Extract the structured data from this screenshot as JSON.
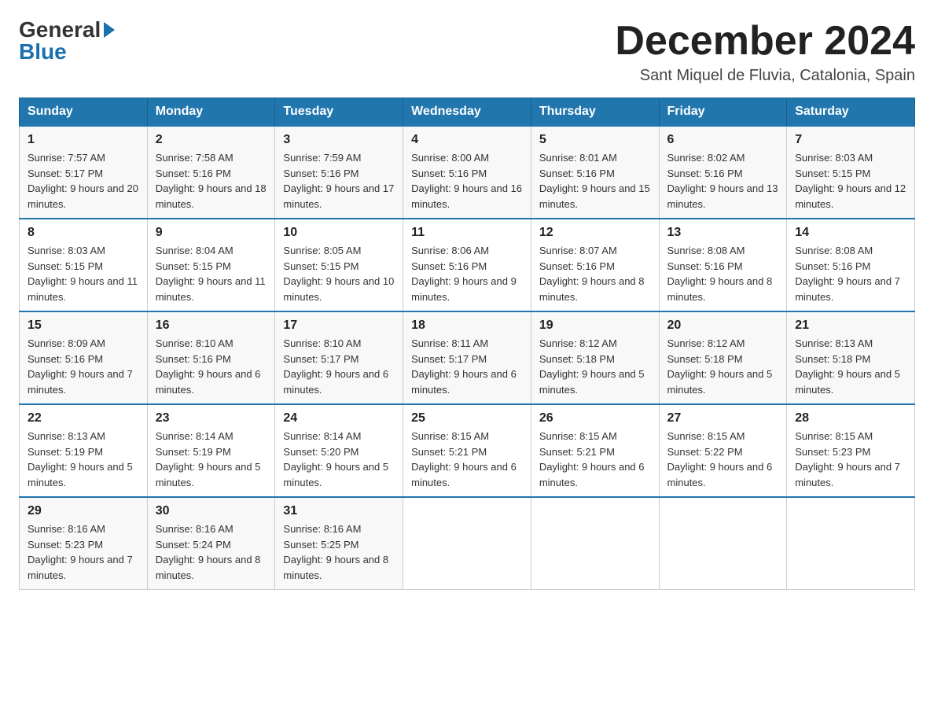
{
  "header": {
    "logo_general": "General",
    "logo_blue": "Blue",
    "month_title": "December 2024",
    "location": "Sant Miquel de Fluvia, Catalonia, Spain"
  },
  "calendar": {
    "days_of_week": [
      "Sunday",
      "Monday",
      "Tuesday",
      "Wednesday",
      "Thursday",
      "Friday",
      "Saturday"
    ],
    "weeks": [
      [
        {
          "day": "1",
          "sunrise": "7:57 AM",
          "sunset": "5:17 PM",
          "daylight": "9 hours and 20 minutes."
        },
        {
          "day": "2",
          "sunrise": "7:58 AM",
          "sunset": "5:16 PM",
          "daylight": "9 hours and 18 minutes."
        },
        {
          "day": "3",
          "sunrise": "7:59 AM",
          "sunset": "5:16 PM",
          "daylight": "9 hours and 17 minutes."
        },
        {
          "day": "4",
          "sunrise": "8:00 AM",
          "sunset": "5:16 PM",
          "daylight": "9 hours and 16 minutes."
        },
        {
          "day": "5",
          "sunrise": "8:01 AM",
          "sunset": "5:16 PM",
          "daylight": "9 hours and 15 minutes."
        },
        {
          "day": "6",
          "sunrise": "8:02 AM",
          "sunset": "5:16 PM",
          "daylight": "9 hours and 13 minutes."
        },
        {
          "day": "7",
          "sunrise": "8:03 AM",
          "sunset": "5:15 PM",
          "daylight": "9 hours and 12 minutes."
        }
      ],
      [
        {
          "day": "8",
          "sunrise": "8:03 AM",
          "sunset": "5:15 PM",
          "daylight": "9 hours and 11 minutes."
        },
        {
          "day": "9",
          "sunrise": "8:04 AM",
          "sunset": "5:15 PM",
          "daylight": "9 hours and 11 minutes."
        },
        {
          "day": "10",
          "sunrise": "8:05 AM",
          "sunset": "5:15 PM",
          "daylight": "9 hours and 10 minutes."
        },
        {
          "day": "11",
          "sunrise": "8:06 AM",
          "sunset": "5:16 PM",
          "daylight": "9 hours and 9 minutes."
        },
        {
          "day": "12",
          "sunrise": "8:07 AM",
          "sunset": "5:16 PM",
          "daylight": "9 hours and 8 minutes."
        },
        {
          "day": "13",
          "sunrise": "8:08 AM",
          "sunset": "5:16 PM",
          "daylight": "9 hours and 8 minutes."
        },
        {
          "day": "14",
          "sunrise": "8:08 AM",
          "sunset": "5:16 PM",
          "daylight": "9 hours and 7 minutes."
        }
      ],
      [
        {
          "day": "15",
          "sunrise": "8:09 AM",
          "sunset": "5:16 PM",
          "daylight": "9 hours and 7 minutes."
        },
        {
          "day": "16",
          "sunrise": "8:10 AM",
          "sunset": "5:16 PM",
          "daylight": "9 hours and 6 minutes."
        },
        {
          "day": "17",
          "sunrise": "8:10 AM",
          "sunset": "5:17 PM",
          "daylight": "9 hours and 6 minutes."
        },
        {
          "day": "18",
          "sunrise": "8:11 AM",
          "sunset": "5:17 PM",
          "daylight": "9 hours and 6 minutes."
        },
        {
          "day": "19",
          "sunrise": "8:12 AM",
          "sunset": "5:18 PM",
          "daylight": "9 hours and 5 minutes."
        },
        {
          "day": "20",
          "sunrise": "8:12 AM",
          "sunset": "5:18 PM",
          "daylight": "9 hours and 5 minutes."
        },
        {
          "day": "21",
          "sunrise": "8:13 AM",
          "sunset": "5:18 PM",
          "daylight": "9 hours and 5 minutes."
        }
      ],
      [
        {
          "day": "22",
          "sunrise": "8:13 AM",
          "sunset": "5:19 PM",
          "daylight": "9 hours and 5 minutes."
        },
        {
          "day": "23",
          "sunrise": "8:14 AM",
          "sunset": "5:19 PM",
          "daylight": "9 hours and 5 minutes."
        },
        {
          "day": "24",
          "sunrise": "8:14 AM",
          "sunset": "5:20 PM",
          "daylight": "9 hours and 5 minutes."
        },
        {
          "day": "25",
          "sunrise": "8:15 AM",
          "sunset": "5:21 PM",
          "daylight": "9 hours and 6 minutes."
        },
        {
          "day": "26",
          "sunrise": "8:15 AM",
          "sunset": "5:21 PM",
          "daylight": "9 hours and 6 minutes."
        },
        {
          "day": "27",
          "sunrise": "8:15 AM",
          "sunset": "5:22 PM",
          "daylight": "9 hours and 6 minutes."
        },
        {
          "day": "28",
          "sunrise": "8:15 AM",
          "sunset": "5:23 PM",
          "daylight": "9 hours and 7 minutes."
        }
      ],
      [
        {
          "day": "29",
          "sunrise": "8:16 AM",
          "sunset": "5:23 PM",
          "daylight": "9 hours and 7 minutes."
        },
        {
          "day": "30",
          "sunrise": "8:16 AM",
          "sunset": "5:24 PM",
          "daylight": "9 hours and 8 minutes."
        },
        {
          "day": "31",
          "sunrise": "8:16 AM",
          "sunset": "5:25 PM",
          "daylight": "9 hours and 8 minutes."
        },
        null,
        null,
        null,
        null
      ]
    ]
  }
}
